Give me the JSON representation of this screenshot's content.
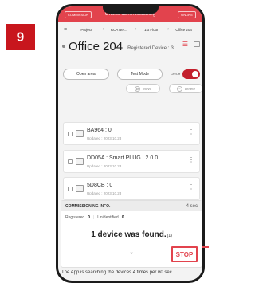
{
  "step": "9",
  "header": {
    "left_tab": "COMMISSION",
    "title": "Offline commissioning",
    "right_tab": "ONLINE"
  },
  "breadcrumb": [
    "Project",
    "RCA Bel...",
    "1st Floor",
    "Office 204"
  ],
  "room": {
    "title": "Office 204",
    "registered_label": "Registered Device :",
    "registered_count": "3"
  },
  "controls": {
    "open_area": "Open area",
    "test_mode": "Test Mode",
    "onoff_label": "On/Off",
    "toggle_on": true
  },
  "actions": {
    "move": "Move",
    "delete": "Delete"
  },
  "devices": [
    {
      "name": "BA964 : 0",
      "updated": "Updated : 2023.10.23"
    },
    {
      "name": "DD05A : Smart PLUG : 2.0.0",
      "updated": "Updated : 2023.10.23"
    },
    {
      "name": "5D8CB : 0",
      "updated": "Updated : 2023.10.23"
    }
  ],
  "commissioning": {
    "title": "COMMISSIONING INFO.",
    "timer": "4 sec",
    "registered_label": "Registered",
    "registered_value": "0",
    "unidentified_label": "Unidentified",
    "unidentified_value": "0",
    "found_text": "1 device was found.",
    "footnote": "(1)",
    "stop_label": "STOP"
  },
  "footer_message": "The App is searching the devices 4 times per 60 sec...",
  "colors": {
    "accent": "#e2434d",
    "step_badge": "#c8161d",
    "toggle": "#c31f2c"
  }
}
